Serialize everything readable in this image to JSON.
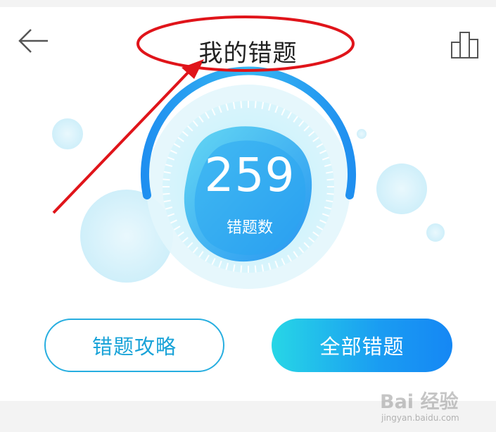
{
  "header": {
    "title": "我的错题",
    "back_icon": "arrow-left-icon",
    "stats_icon": "bar-chart-icon"
  },
  "summary": {
    "count": "259",
    "label": "错题数"
  },
  "actions": {
    "strategy_label": "错题攻略",
    "all_label": "全部错题"
  },
  "annotation": {
    "color": "#e0141a"
  },
  "watermark": {
    "main": "Bai 经验",
    "sub": "jingyan.baidu.com"
  },
  "colors": {
    "accent": "#1a9cf2",
    "accent_light": "#27d6e6",
    "outline": "#27aee0"
  }
}
